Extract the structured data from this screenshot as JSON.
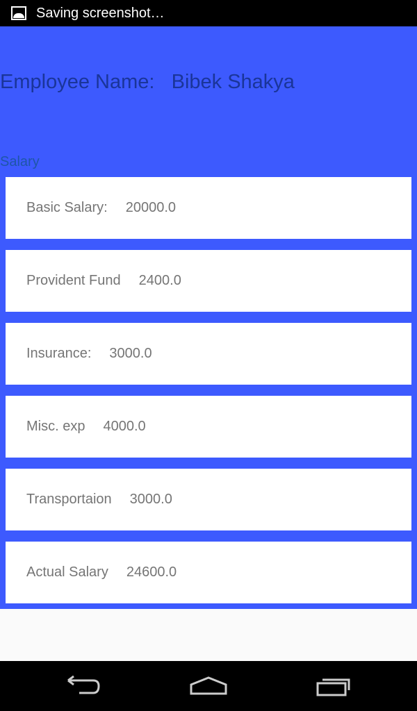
{
  "status_bar": {
    "notification": "Saving screenshot…"
  },
  "header": {
    "label": "Employee Name:",
    "name": "Bibek Shakya"
  },
  "section_title": "Salary",
  "items": [
    {
      "label": "Basic Salary:",
      "value": "20000.0"
    },
    {
      "label": "Provident Fund",
      "value": "2400.0"
    },
    {
      "label": "Insurance:",
      "value": "3000.0"
    },
    {
      "label": "Misc. exp",
      "value": "4000.0"
    },
    {
      "label": "Transportaion",
      "value": "3000.0"
    },
    {
      "label": "Actual Salary",
      "value": "24600.0"
    }
  ],
  "colors": {
    "primary": "#3d5afe",
    "card": "#ffffff",
    "text": "#757575"
  }
}
